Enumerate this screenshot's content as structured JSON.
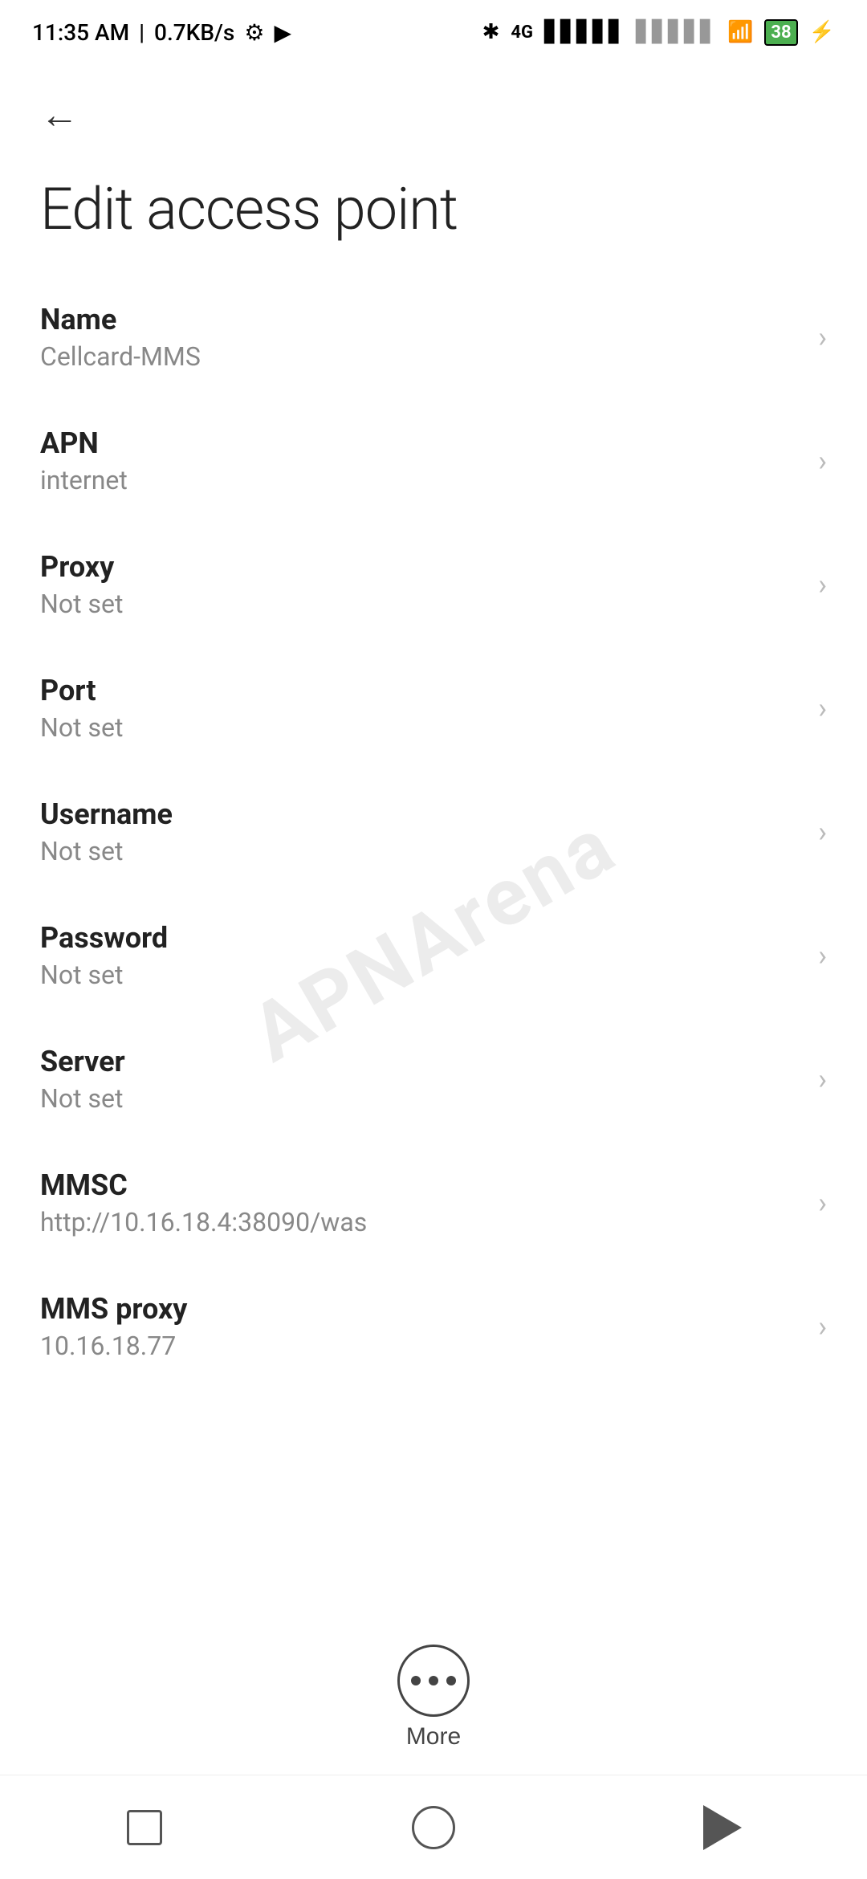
{
  "statusBar": {
    "time": "11:35 AM",
    "network": "0.7KB/s",
    "batteryLevel": "38"
  },
  "navigation": {
    "backLabel": "←"
  },
  "pageTitle": "Edit access point",
  "settingsItems": [
    {
      "id": "name",
      "label": "Name",
      "value": "Cellcard-MMS"
    },
    {
      "id": "apn",
      "label": "APN",
      "value": "internet"
    },
    {
      "id": "proxy",
      "label": "Proxy",
      "value": "Not set"
    },
    {
      "id": "port",
      "label": "Port",
      "value": "Not set"
    },
    {
      "id": "username",
      "label": "Username",
      "value": "Not set"
    },
    {
      "id": "password",
      "label": "Password",
      "value": "Not set"
    },
    {
      "id": "server",
      "label": "Server",
      "value": "Not set"
    },
    {
      "id": "mmsc",
      "label": "MMSC",
      "value": "http://10.16.18.4:38090/was"
    },
    {
      "id": "mms-proxy",
      "label": "MMS proxy",
      "value": "10.16.18.77"
    }
  ],
  "moreButton": {
    "label": "More"
  },
  "watermark": "APNArena"
}
